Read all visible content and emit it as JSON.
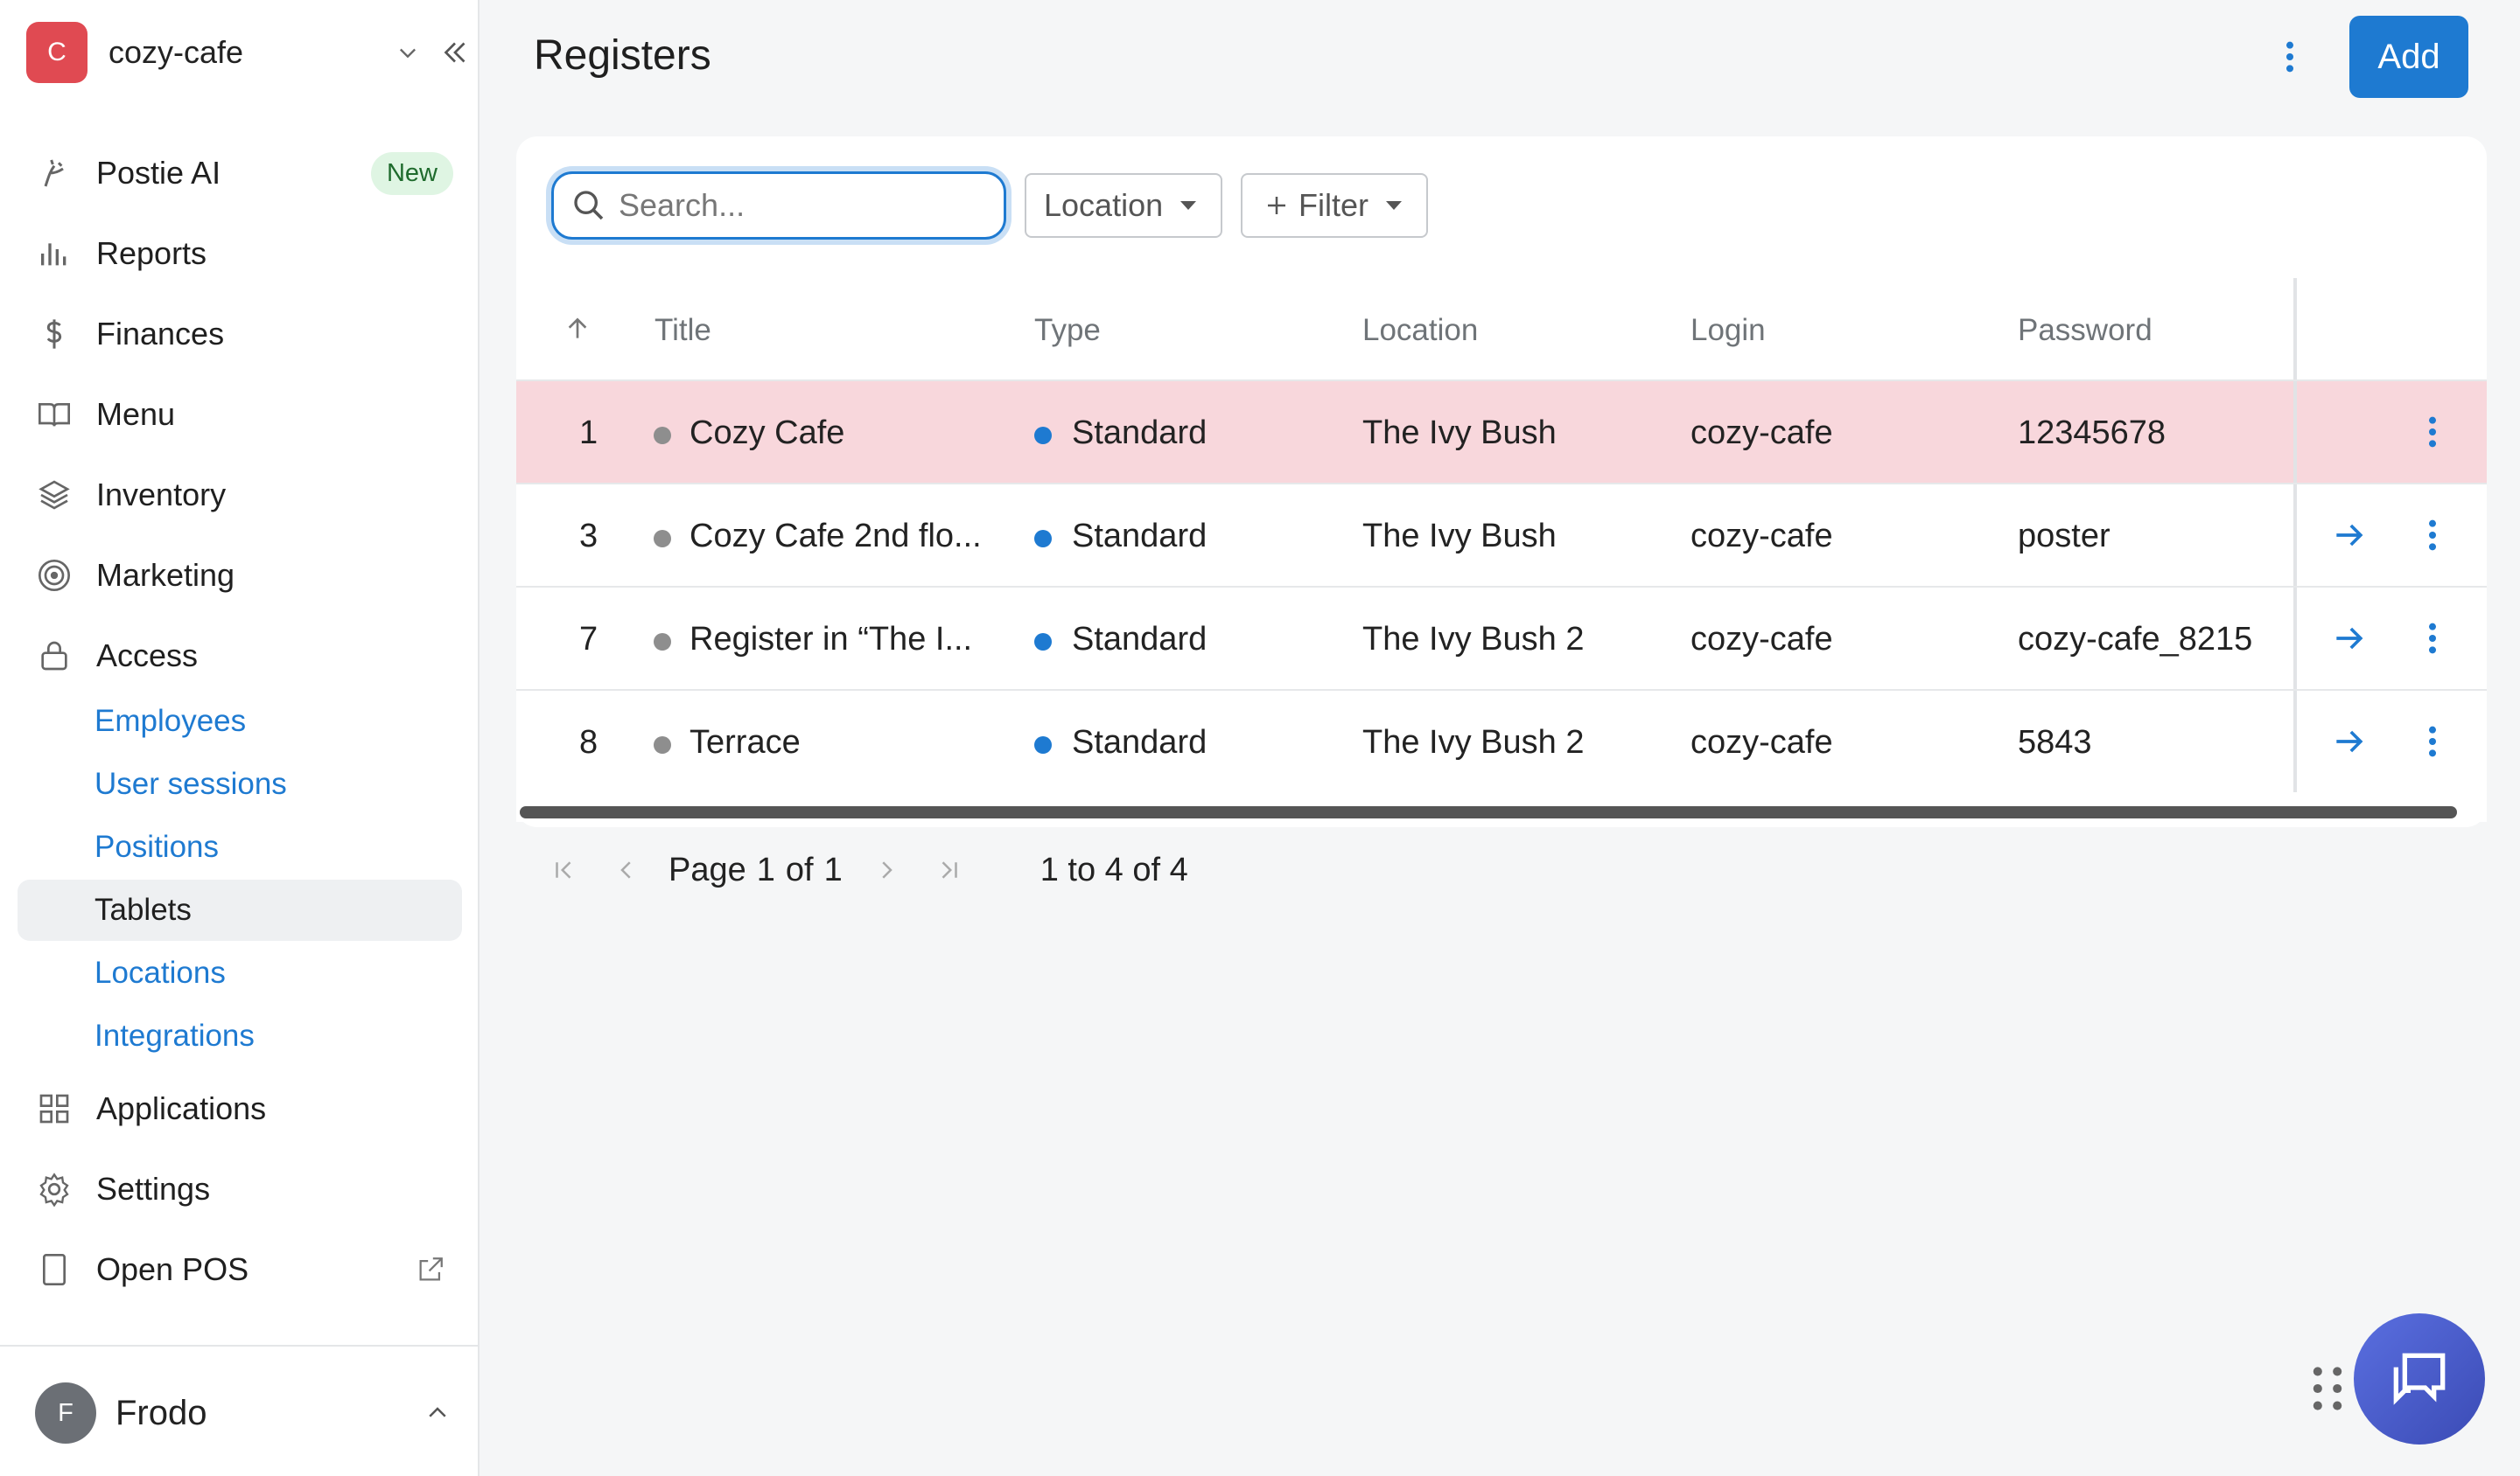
{
  "account": {
    "initial": "C",
    "name": "cozy-cafe"
  },
  "nav": {
    "postie_ai": "Postie AI",
    "new_badge": "New",
    "reports": "Reports",
    "finances": "Finances",
    "menu": "Menu",
    "inventory": "Inventory",
    "marketing": "Marketing",
    "access": "Access",
    "access_items": [
      "Employees",
      "User sessions",
      "Positions",
      "Tablets",
      "Locations",
      "Integrations"
    ],
    "applications": "Applications",
    "settings": "Settings",
    "open_pos": "Open POS"
  },
  "user": {
    "initial": "F",
    "name": "Frodo"
  },
  "page": {
    "title": "Registers",
    "add_label": "Add"
  },
  "toolbar": {
    "search_placeholder": "Search...",
    "location_label": "Location",
    "filter_label": "Filter"
  },
  "table": {
    "headers": {
      "title": "Title",
      "type": "Type",
      "location": "Location",
      "login": "Login",
      "password": "Password"
    },
    "rows": [
      {
        "id": "1",
        "title": "Cozy Cafe",
        "type": "Standard",
        "location": "The Ivy Bush",
        "login": "cozy-cafe",
        "password": "12345678"
      },
      {
        "id": "3",
        "title": "Cozy Cafe 2nd flo...",
        "type": "Standard",
        "location": "The Ivy Bush",
        "login": "cozy-cafe",
        "password": "poster"
      },
      {
        "id": "7",
        "title": "Register in “The I...",
        "type": "Standard",
        "location": "The Ivy Bush 2",
        "login": "cozy-cafe",
        "password": "cozy-cafe_8215"
      },
      {
        "id": "8",
        "title": "Terrace",
        "type": "Standard",
        "location": "The Ivy Bush 2",
        "login": "cozy-cafe",
        "password": "5843"
      }
    ]
  },
  "pagination": {
    "page_word": "Page",
    "current": "1",
    "of_word": "of",
    "total": "1",
    "range": "1 to 4 of 4"
  },
  "colors": {
    "accent": "#1e7ad1",
    "highlight_row": "#f8d7dc",
    "account_avatar": "#e04a52",
    "new_badge_bg": "#dff5e3"
  }
}
